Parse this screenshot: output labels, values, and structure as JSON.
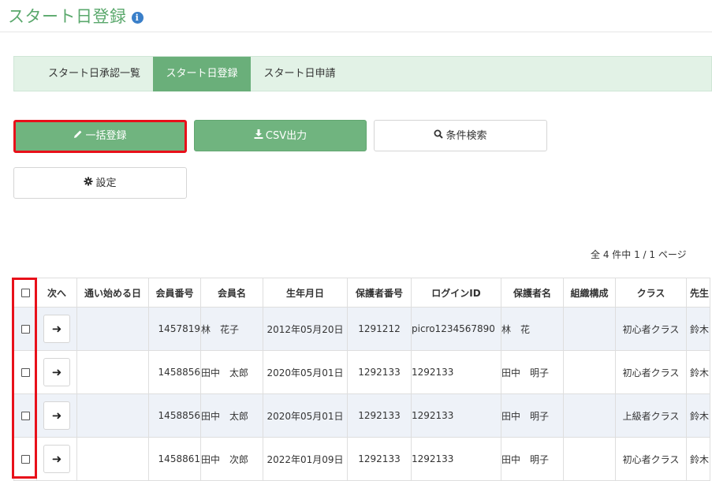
{
  "page": {
    "title": "スタート日登録",
    "info_icon": "i"
  },
  "tabs": [
    {
      "label": "スタート日承認一覧"
    },
    {
      "label": "スタート日登録",
      "active": true
    },
    {
      "label": "スタート日申請"
    }
  ],
  "buttons": {
    "bulk_register": {
      "icon": "pencil-icon",
      "label": "一括登録"
    },
    "csv_export": {
      "icon": "download-icon",
      "label": "CSV出力"
    },
    "search": {
      "icon": "search-icon",
      "label": "条件検索"
    },
    "settings": {
      "icon": "gear-icon",
      "label": "設定"
    }
  },
  "pager": {
    "text": "全 4 件中 1 / 1 ページ"
  },
  "table": {
    "columns": [
      "次へ",
      "通い始める日",
      "会員番号",
      "会員名",
      "生年月日",
      "保護者番号",
      "ログインID",
      "保護者名",
      "組織構成",
      "クラス",
      "先生"
    ],
    "rows": [
      {
        "start_date": "",
        "member_no": "1457819",
        "name": "林　花子",
        "birthday": "2012年05月20日",
        "guardian_no": "1291212",
        "login_id": "picro1234567890",
        "guardian_name": "林　花",
        "org": "",
        "class": "初心者クラス",
        "teacher": "鈴木"
      },
      {
        "start_date": "",
        "member_no": "1458856",
        "name": "田中　太郎",
        "birthday": "2020年05月01日",
        "guardian_no": "1292133",
        "login_id": "1292133",
        "guardian_name": "田中　明子",
        "org": "",
        "class": "初心者クラス",
        "teacher": "鈴木"
      },
      {
        "start_date": "",
        "member_no": "1458856",
        "name": "田中　太郎",
        "birthday": "2020年05月01日",
        "guardian_no": "1292133",
        "login_id": "1292133",
        "guardian_name": "田中　明子",
        "org": "",
        "class": "上級者クラス",
        "teacher": "鈴木"
      },
      {
        "start_date": "",
        "member_no": "1458861",
        "name": "田中　次郎",
        "birthday": "2022年01月09日",
        "guardian_no": "1292133",
        "login_id": "1292133",
        "guardian_name": "田中　明子",
        "org": "",
        "class": "初心者クラス",
        "teacher": "鈴木"
      }
    ],
    "next_arrow": "➜"
  },
  "colors": {
    "accent": "#6aaf7a",
    "tab_bg": "#e2f2e6",
    "highlight": "#e8101a",
    "row_alt": "#eef2f8"
  }
}
